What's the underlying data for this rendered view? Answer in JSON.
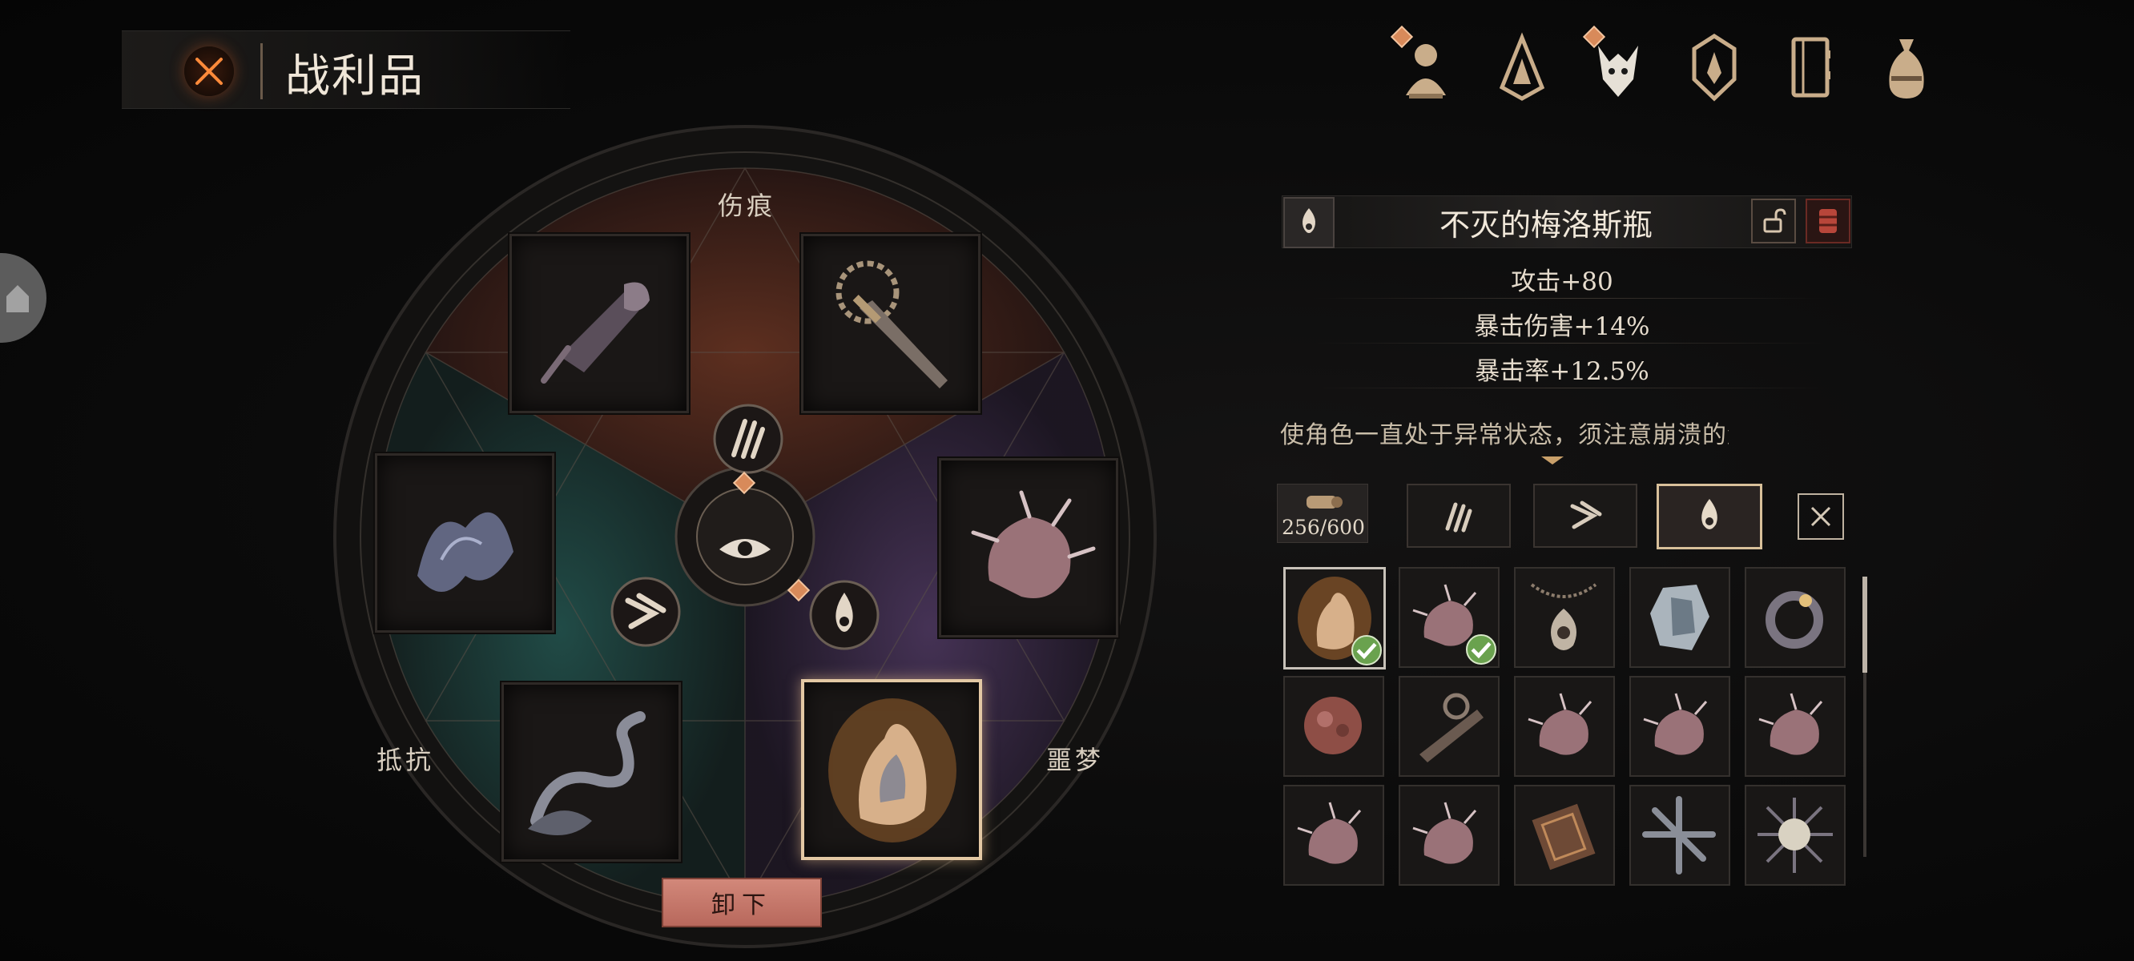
{
  "header": {
    "title": "战利品",
    "close_icon": "crossed-swords-icon"
  },
  "nav": {
    "items": [
      {
        "icon": "character-bust-icon",
        "badge": true
      },
      {
        "icon": "hooded-mask-icon",
        "badge": false
      },
      {
        "icon": "beast-skull-icon",
        "badge": true
      },
      {
        "icon": "crest-shield-icon",
        "badge": false
      },
      {
        "icon": "journal-book-icon",
        "badge": false
      },
      {
        "icon": "loot-bag-icon",
        "badge": false
      }
    ]
  },
  "wheel": {
    "labels": {
      "wound": "伤痕",
      "resist": "抵抗",
      "nightmare": "噩梦"
    },
    "unequip_label": "卸下",
    "colors": {
      "wound": "#4a2620",
      "resist": "#1f3a3a",
      "nightmare": "#352641",
      "accent": "#e3c8a4"
    }
  },
  "detail": {
    "item_name": "不灭的梅洛斯瓶",
    "stats": [
      "攻击+80",
      "暴击伤害+14%",
      "暴击率+12.5%"
    ],
    "description": "使角色一直处于异常状态，须注意崩溃的危险。无",
    "emblem_icon": "flame-sigil-icon",
    "lock_icon": "unlock-icon",
    "delete_icon": "trash-barrel-icon"
  },
  "inventory": {
    "capacity": "256/600",
    "filters": [
      {
        "icon": "claw-marks-icon",
        "active": false
      },
      {
        "icon": "resist-chevron-icon",
        "active": false
      },
      {
        "icon": "flame-sigil-icon",
        "active": true
      }
    ],
    "clear_icon": "close-x-icon"
  }
}
